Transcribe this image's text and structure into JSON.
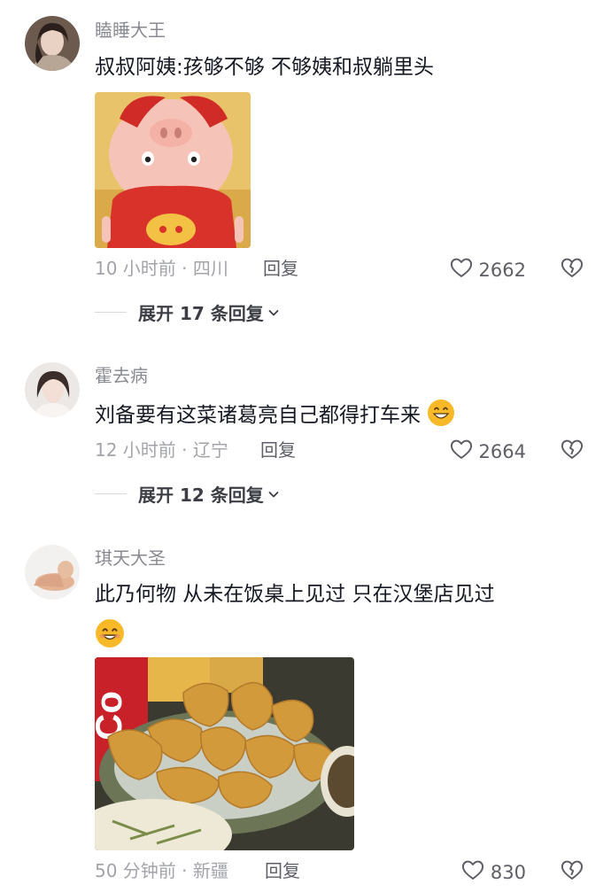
{
  "comments": [
    {
      "username": "瞌睡大王",
      "text": "叔叔阿姨:孩够不够 不够姨和叔躺里头",
      "time_location": "10 小时前 · 四川",
      "reply_label": "回复",
      "likes": "2662",
      "expand_label": "展开 17 条回复"
    },
    {
      "username": "霍去病",
      "text": "刘备要有这菜诸葛亮自己都得打车来",
      "time_location": "12 小时前 · 辽宁",
      "reply_label": "回复",
      "likes": "2664",
      "expand_label": "展开 12 条回复"
    },
    {
      "username": "琪天大圣",
      "text": "此乃何物  从未在饭桌上见过  只在汉堡店见过",
      "time_location": "50 分钟前 · 新疆",
      "reply_label": "回复",
      "likes": "830"
    }
  ],
  "icons": {
    "like": "heart-outline-icon",
    "dislike": "broken-heart-icon",
    "expand": "chevron-down-icon",
    "emoji": "grin-emoji-icon"
  },
  "colors": {
    "username": "#8a8b91",
    "meta": "#a3a4a9",
    "text": "#161823",
    "emoji": "#f7b928"
  }
}
